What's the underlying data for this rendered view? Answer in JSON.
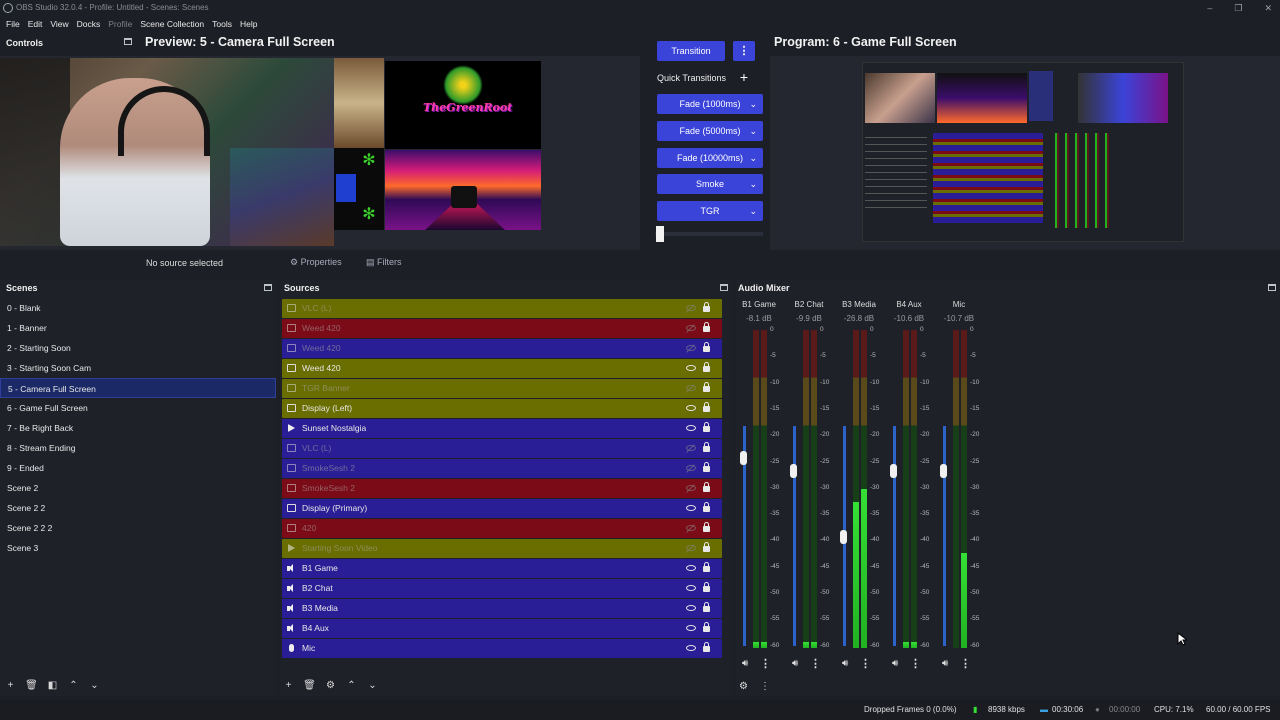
{
  "window": {
    "title": "OBS Studio 32.0.4 - Profile: Untitled - Scenes: Scenes"
  },
  "menu": [
    "File",
    "Edit",
    "View",
    "Docks",
    "Profile",
    "Scene Collection",
    "Tools",
    "Help"
  ],
  "controls": {
    "title": "Controls"
  },
  "preview": {
    "title": "Preview: 5 - Camera Full Screen",
    "logo_text": "TheGreenRoot"
  },
  "program": {
    "title": "Program: 6 - Game Full Screen"
  },
  "transitions": {
    "transition_label": "Transition",
    "quick_label": "Quick Transitions",
    "add_symbol": "+",
    "menu_symbol": "⋮",
    "buttons": [
      "Fade (1000ms)",
      "Fade (5000ms)",
      "Fade (10000ms)",
      "Smoke",
      "TGR"
    ]
  },
  "source_toolbar": {
    "no_source": "No source selected",
    "properties": "Properties",
    "filters": "Filters"
  },
  "scenes": {
    "title": "Scenes",
    "selected_index": 5,
    "items": [
      "0 - Blank",
      "1 - Banner",
      "2 - Starting Soon",
      "3 - Starting Soon Cam",
      "5 - Camera Full Screen",
      "6 - Game Full Screen",
      "7 - Be Right Back",
      "8 - Stream Ending",
      "9 - Ended",
      "Scene 2",
      "Scene 2 2",
      "Scene 2 2 2",
      "Scene 3"
    ]
  },
  "sources": {
    "title": "Sources",
    "items": [
      {
        "label": "VLC (L)",
        "color": "yellow",
        "icon": "window-icon",
        "visible": false
      },
      {
        "label": "Weed 420",
        "color": "red",
        "icon": "image-icon",
        "visible": false
      },
      {
        "label": "Weed 420",
        "color": "blue",
        "icon": "image-icon",
        "visible": false
      },
      {
        "label": "Weed 420",
        "color": "yellow",
        "icon": "image-icon",
        "visible": true
      },
      {
        "label": "TGR Banner",
        "color": "yellow",
        "icon": "image-icon",
        "visible": false
      },
      {
        "label": "Display (Left)",
        "color": "yellow",
        "icon": "monitor-icon",
        "visible": true
      },
      {
        "label": "Sunset Nostalgia",
        "color": "blue",
        "icon": "play-icon",
        "visible": true
      },
      {
        "label": "VLC (L)",
        "color": "blue",
        "icon": "window-icon",
        "visible": false
      },
      {
        "label": "SmokeSesh 2",
        "color": "blue",
        "icon": "image-icon",
        "visible": false
      },
      {
        "label": "SmokeSesh 2",
        "color": "red",
        "icon": "image-icon",
        "visible": false
      },
      {
        "label": "Display (Primary)",
        "color": "blue",
        "icon": "monitor-icon",
        "visible": true
      },
      {
        "label": "420",
        "color": "red",
        "icon": "image-icon",
        "visible": false
      },
      {
        "label": "Starting Soon Video",
        "color": "yellow",
        "icon": "play-icon",
        "visible": false
      },
      {
        "label": "B1 Game",
        "color": "blue",
        "icon": "speaker-icon",
        "visible": true
      },
      {
        "label": "B2 Chat",
        "color": "blue",
        "icon": "speaker-icon",
        "visible": true
      },
      {
        "label": "B3 Media",
        "color": "blue",
        "icon": "speaker-icon",
        "visible": true
      },
      {
        "label": "B4 Aux",
        "color": "blue",
        "icon": "speaker-icon",
        "visible": true
      },
      {
        "label": "Mic",
        "color": "blue",
        "icon": "mic-icon",
        "visible": true
      }
    ]
  },
  "mixer": {
    "title": "Audio Mixer",
    "scale": [
      "0",
      "-5",
      "-10",
      "-15",
      "-20",
      "-25",
      "-30",
      "-35",
      "-40",
      "-45",
      "-50",
      "-55",
      "-60"
    ],
    "channels": [
      {
        "name": "B1 Game",
        "db": "-8.1 dB",
        "fader": 0.62,
        "levels": [
          0.02,
          0.02
        ]
      },
      {
        "name": "B2 Chat",
        "db": "-9.9 dB",
        "fader": 0.58,
        "levels": [
          0.02,
          0.02
        ]
      },
      {
        "name": "B3 Media",
        "db": "-26.8 dB",
        "fader": 0.37,
        "levels": [
          0.46,
          0.5
        ]
      },
      {
        "name": "B4 Aux",
        "db": "-10.6 dB",
        "fader": 0.58,
        "levels": [
          0.02,
          0.02
        ]
      },
      {
        "name": "Mic",
        "db": "-10.7 dB",
        "fader": 0.58,
        "levels": [
          0.0,
          0.3
        ]
      }
    ]
  },
  "status": {
    "dropped": "Dropped Frames 0 (0.0%)",
    "kbps": "8938 kbps",
    "stream_time": "00:30:06",
    "rec_time": "00:00:00",
    "cpu": "CPU: 7.1%",
    "fps": "60.00 / 60.00 FPS"
  },
  "colors": {
    "accent": "#3b44d9",
    "yellow_row": "#6a6d00",
    "red_row": "#7c0b18",
    "blue_row": "#2a1e96",
    "meter_green": "#35e035"
  }
}
